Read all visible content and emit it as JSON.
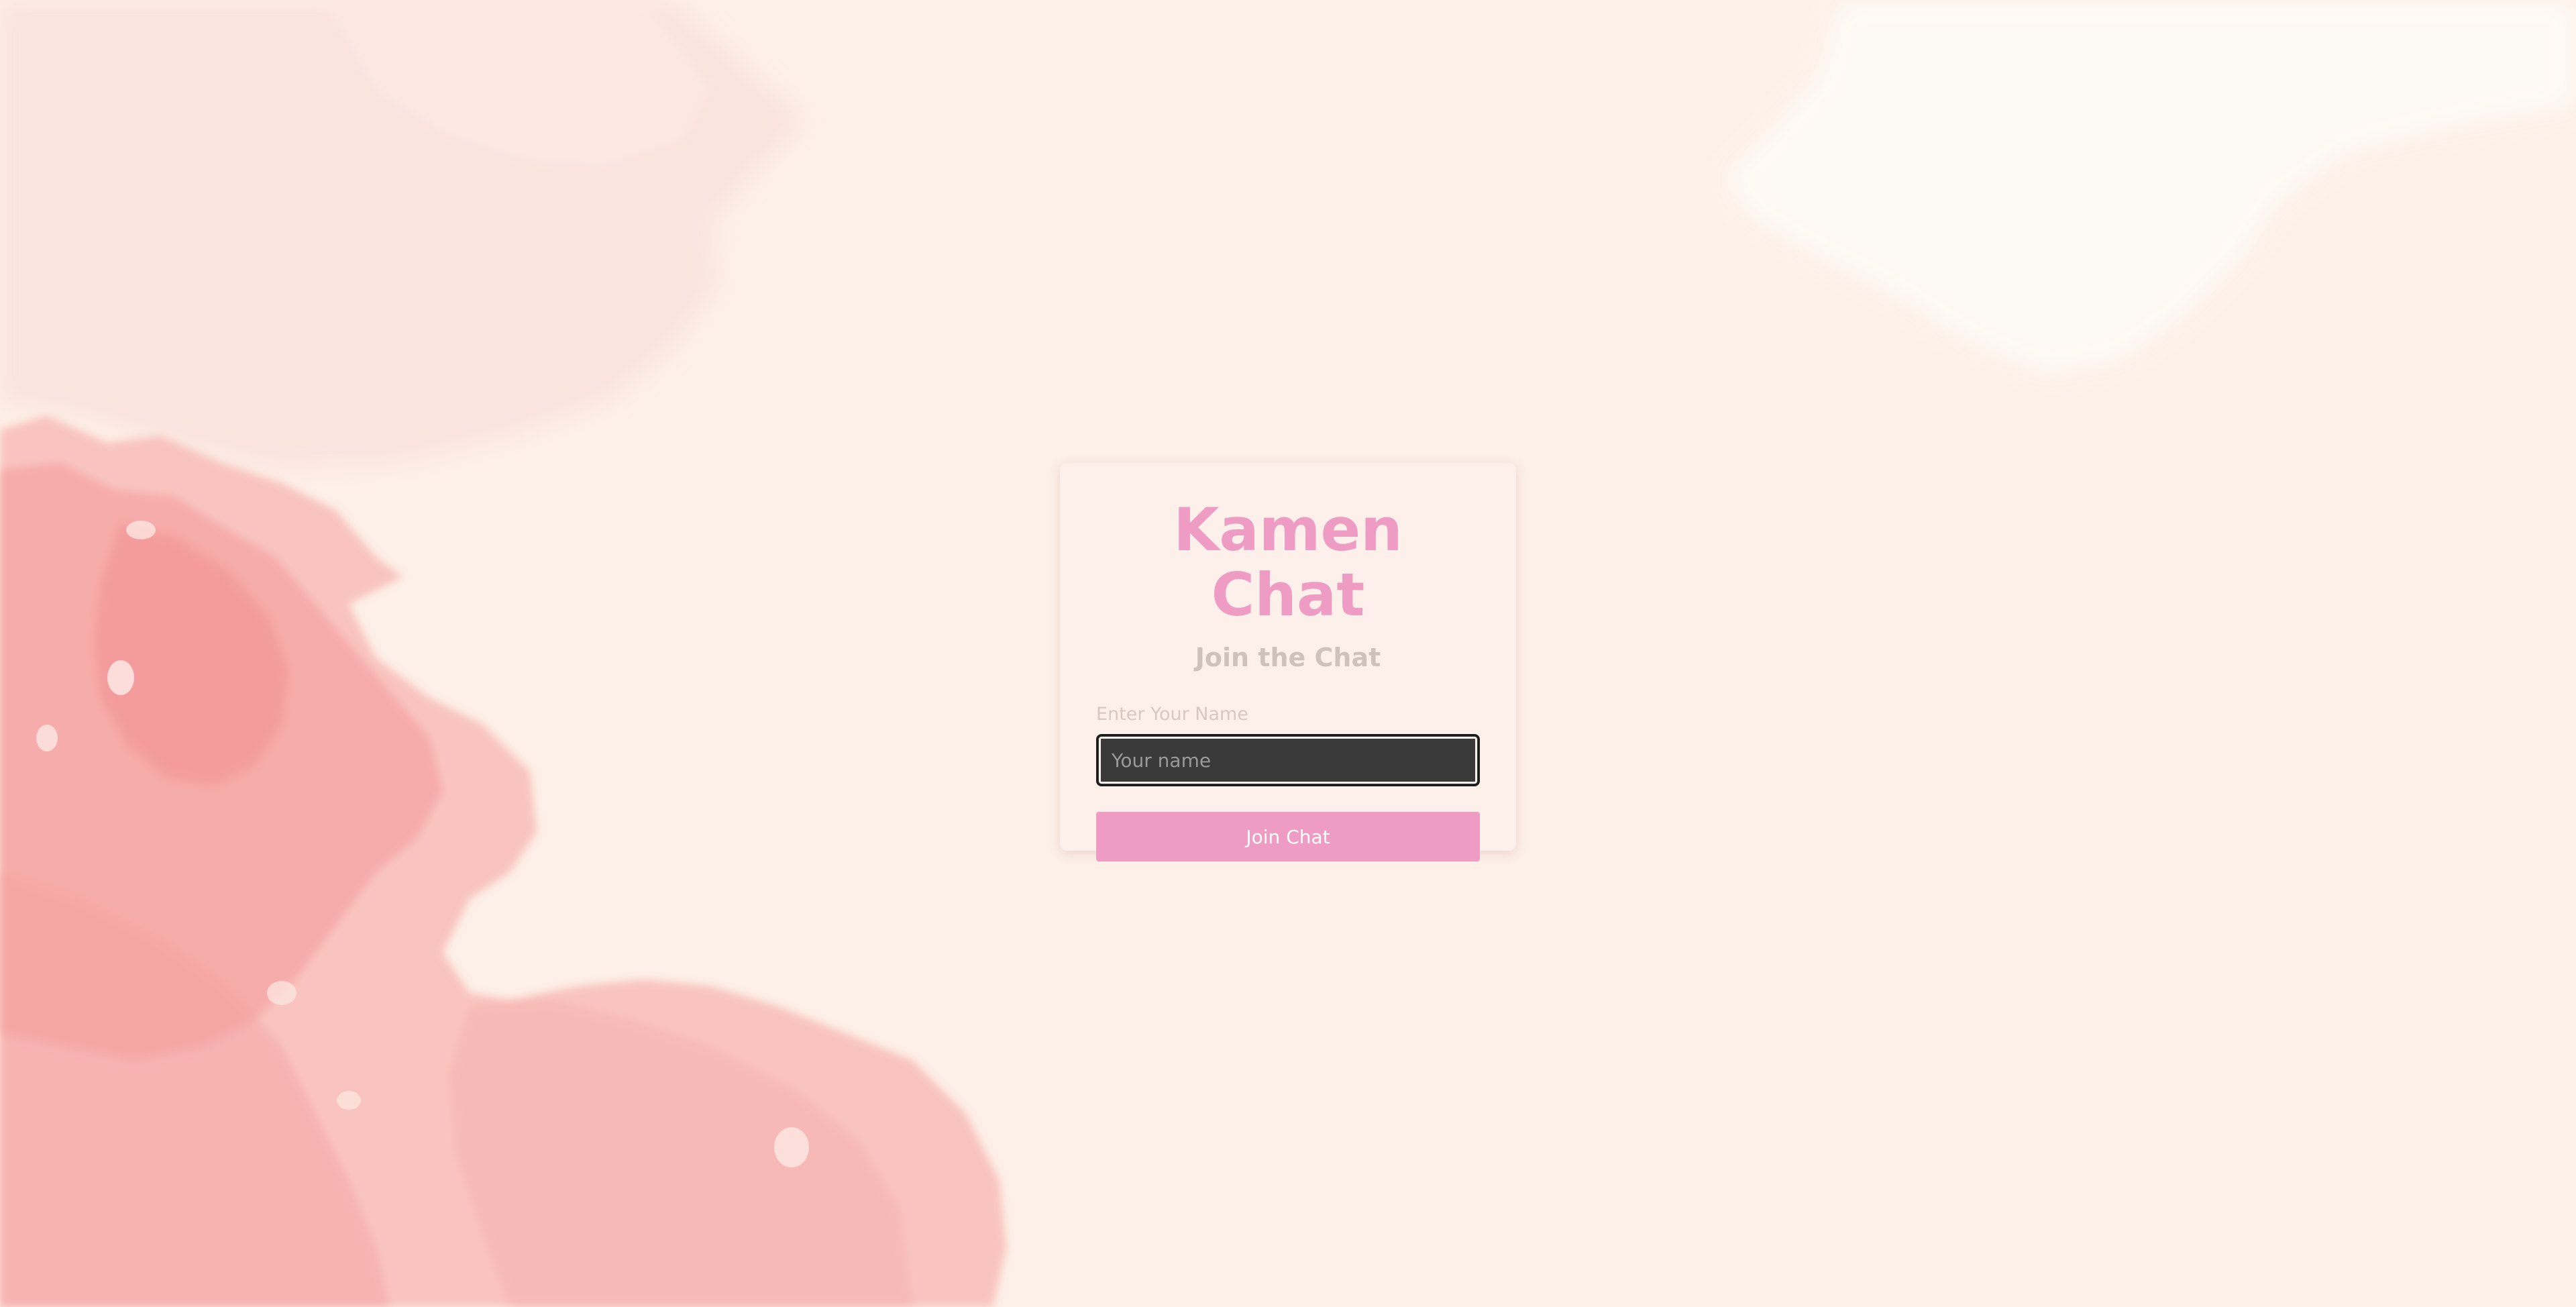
{
  "app": {
    "title": "Kamen Chat",
    "subtitle": "Join the Chat"
  },
  "form": {
    "name_label": "Enter Your Name",
    "name_placeholder": "Your name",
    "name_value": "",
    "join_label": "Join Chat"
  },
  "colors": {
    "page_background": "#fdf0e8",
    "card_background": "#fdf0ea",
    "accent_pink": "#ee9cc4",
    "subtitle_text": "#cfc1bb",
    "label_text": "#d7c8c2",
    "input_background": "#3a3a3a",
    "watercolor_pink": "#f7a6a6"
  }
}
